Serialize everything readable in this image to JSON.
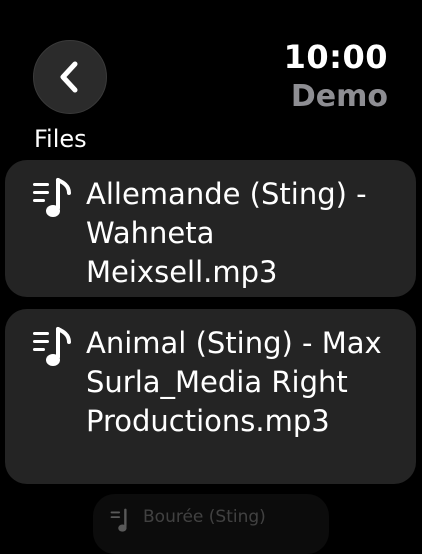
{
  "header": {
    "back_icon": "chevron-left-icon",
    "time": "10:00",
    "app_title": "Demo"
  },
  "section": {
    "label": "Files"
  },
  "files": [
    {
      "name": "Allemande (Sting) - Wahneta Meixsell.mp3",
      "icon": "playlist-music-icon"
    },
    {
      "name": "Animal (Sting) - Max Surla_Media Right Productions.mp3",
      "icon": "playlist-music-icon"
    },
    {
      "name": "Bourée (Sting)",
      "icon": "playlist-music-icon"
    }
  ],
  "colors": {
    "background": "#000000",
    "card": "#242424",
    "secondary_text": "#8e8e93"
  }
}
